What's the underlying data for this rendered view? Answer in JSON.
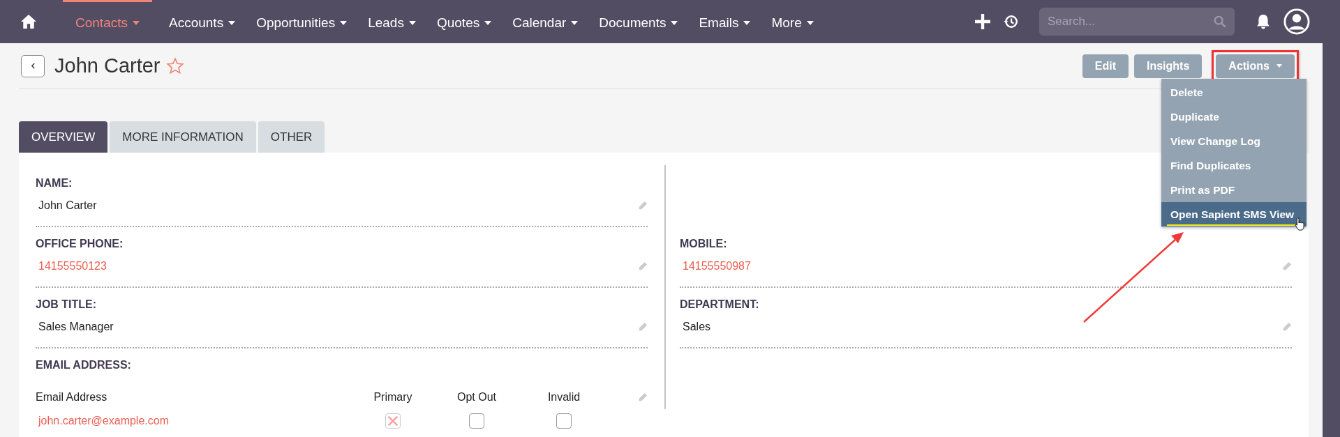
{
  "nav": {
    "items": [
      {
        "label": "Contacts",
        "selected": true
      },
      {
        "label": "Accounts",
        "selected": false
      },
      {
        "label": "Opportunities",
        "selected": false
      },
      {
        "label": "Leads",
        "selected": false
      },
      {
        "label": "Quotes",
        "selected": false
      },
      {
        "label": "Calendar",
        "selected": false
      },
      {
        "label": "Documents",
        "selected": false
      },
      {
        "label": "Emails",
        "selected": false
      },
      {
        "label": "More",
        "selected": false
      }
    ],
    "search": {
      "placeholder": "Search..."
    }
  },
  "record": {
    "title": "John Carter",
    "favorite": false
  },
  "buttons": [
    {
      "label": "Edit",
      "highlighted": false,
      "dropdown": false
    },
    {
      "label": "Insights",
      "highlighted": false,
      "dropdown": false
    },
    {
      "label": "Actions",
      "highlighted": true,
      "dropdown": true
    }
  ],
  "actions_menu": [
    {
      "label": "Delete",
      "selected": false
    },
    {
      "label": "Duplicate",
      "selected": false
    },
    {
      "label": "View Change Log",
      "selected": false
    },
    {
      "label": "Find Duplicates",
      "selected": false
    },
    {
      "label": "Print as PDF",
      "selected": false
    },
    {
      "label": "Open Sapient SMS View",
      "selected": true
    }
  ],
  "tabs": [
    {
      "label": "OVERVIEW",
      "selected": true
    },
    {
      "label": "MORE INFORMATION",
      "selected": false
    },
    {
      "label": "OTHER",
      "selected": false
    }
  ],
  "rows": [
    {
      "left": {
        "label": "NAME:",
        "value": "John Carter",
        "kind": "text"
      },
      "right": null
    },
    {
      "left": {
        "label": "OFFICE PHONE:",
        "value": "14155550123",
        "kind": "link"
      },
      "right": {
        "label": "MOBILE:",
        "value": "14155550987",
        "kind": "link"
      }
    },
    {
      "left": {
        "label": "JOB TITLE:",
        "value": "Sales Manager",
        "kind": "text"
      },
      "right": {
        "label": "DEPARTMENT:",
        "value": "Sales",
        "kind": "text"
      }
    }
  ],
  "email": {
    "label": "EMAIL ADDRESS:",
    "columns": [
      "Email Address",
      "Primary",
      "Opt Out",
      "Invalid"
    ],
    "rows": [
      {
        "address": "john.carter@example.com",
        "primary": true,
        "opt_out": false,
        "invalid": false
      }
    ]
  }
}
